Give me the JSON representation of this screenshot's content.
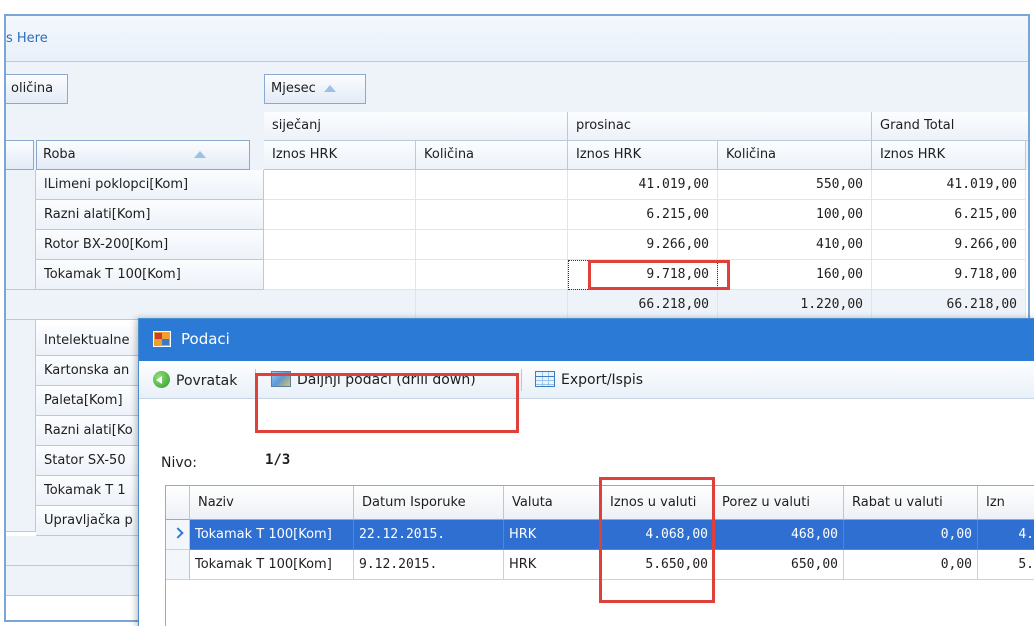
{
  "pivot": {
    "drop_hint": "s Here",
    "filter_field": "oličina",
    "column_field": "Mjesec",
    "row_field": "Roba",
    "col_groups": [
      "siječanj",
      "prosinac",
      "Grand Total"
    ],
    "data_headers": [
      "Iznos HRK",
      "Količina",
      "Iznos HRK",
      "Količina",
      "Iznos HRK"
    ],
    "rows": [
      {
        "label": "lLimeni poklopci[Kom]",
        "pros_iznos": "41.019,00",
        "pros_kol": "550,00",
        "total": "41.019,00"
      },
      {
        "label": "Razni alati[Kom]",
        "pros_iznos": "6.215,00",
        "pros_kol": "100,00",
        "total": "6.215,00"
      },
      {
        "label": "Rotor BX-200[Kom]",
        "pros_iznos": "9.266,00",
        "pros_kol": "410,00",
        "total": "9.266,00"
      },
      {
        "label": "Tokamak T 100[Kom]",
        "pros_iznos": "9.718,00",
        "pros_kol": "160,00",
        "total": "9.718,00"
      }
    ],
    "subtotal": {
      "pros_iznos": "66.218,00",
      "pros_kol": "1.220,00",
      "total": "66.218,00"
    },
    "rows2": [
      "Intelektualne",
      "Kartonska an",
      "Paleta[Kom]",
      "Razni alati[Ko",
      "Stator SX-50",
      "Tokamak T 1",
      "Upravljačka p"
    ]
  },
  "dialog": {
    "title": "Podaci",
    "toolbar": {
      "back": "Povratak",
      "drill": "Daljnji podaci (drill down)",
      "export": "Export/Ispis"
    },
    "nivo_label": "Nivo:",
    "nivo_value": "1/3",
    "columns": [
      "Naziv",
      "Datum Isporuke",
      "Valuta",
      "Iznos u valuti",
      "Porez u valuti",
      "Rabat u valuti",
      "Izn"
    ],
    "rows": [
      {
        "naziv": "Tokamak T 100[Kom]",
        "datum": "22.12.2015.",
        "valuta": "HRK",
        "iznos": "4.068,00",
        "porez": "468,00",
        "rabat": "0,00",
        "izn": "4."
      },
      {
        "naziv": "Tokamak T 100[Kom]",
        "datum": "9.12.2015.",
        "valuta": "HRK",
        "iznos": "5.650,00",
        "porez": "650,00",
        "rabat": "0,00",
        "izn": "5."
      }
    ]
  },
  "colors": {
    "accent": "#2b7ad6",
    "highlight": "#e0403a",
    "selection": "#2f6fd2"
  }
}
